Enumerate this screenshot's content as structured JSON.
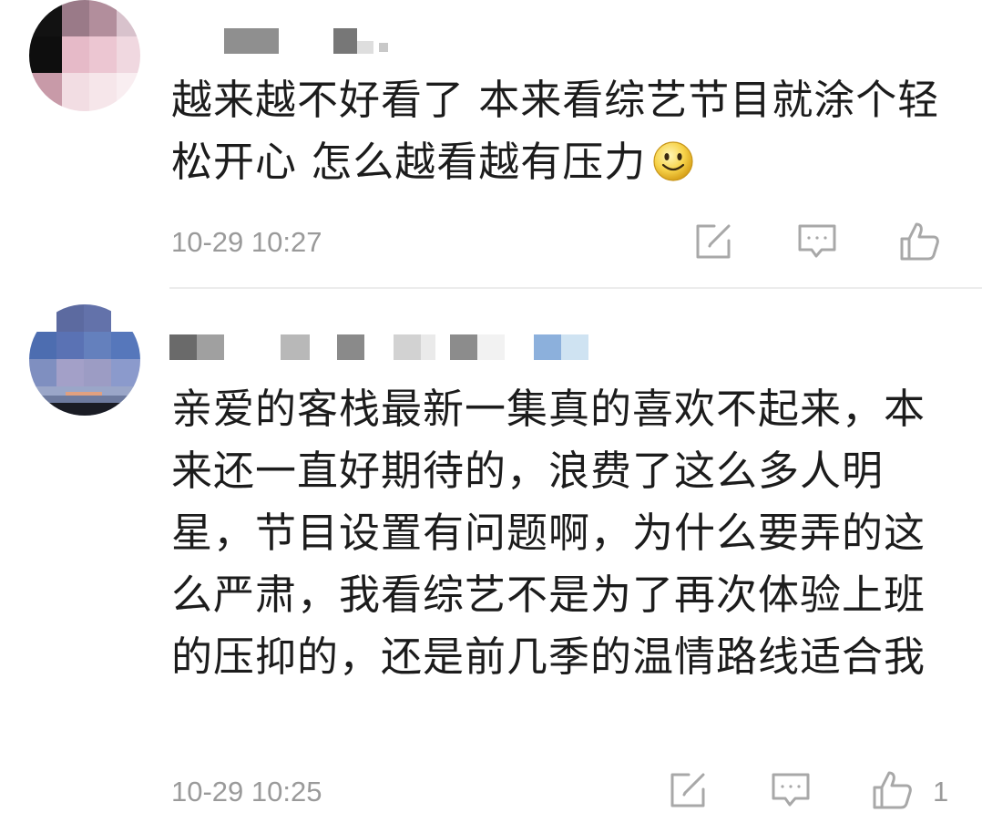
{
  "comments": [
    {
      "text": "越来越不好看了 本来看综艺节目就涂个轻松开心 怎么越看越有压力",
      "time": "10-29 10:27",
      "like_count": ""
    },
    {
      "text": "亲爱的客栈最新一集真的喜欢不起来，本来还一直好期待的，浪费了这么多人明星，节目设置有问题啊，为什么要弄的这么严肃，我看综艺不是为了再次体验上班的压抑的，还是前几季的温情路线适合我",
      "time": "10-29 10:25",
      "like_count": "1"
    }
  ],
  "icons": {
    "emoji": "smiley-emoji",
    "edit": "edit-share-icon",
    "reply": "comment-reply-icon",
    "like": "thumbs-up-icon"
  },
  "colors": {
    "text": "#1c1c1c",
    "meta": "#9a9a9a",
    "icon": "#a8a8a8",
    "divider": "#ececec"
  }
}
